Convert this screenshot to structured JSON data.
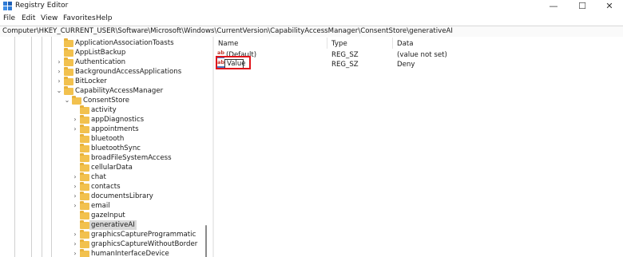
{
  "window": {
    "title": "Registry Editor",
    "icon": "registry-editor-icon"
  },
  "controls": {
    "minimize": "—",
    "maximize": "☐",
    "close": "✕"
  },
  "menu": [
    "File",
    "Edit",
    "View",
    "Favorites",
    "Help"
  ],
  "address": "Computer\\HKEY_CURRENT_USER\\Software\\Microsoft\\Windows\\CurrentVersion\\CapabilityAccessManager\\ConsentStore\\generativeAI",
  "tree": [
    {
      "label": "ApplicationAssociationToasts",
      "chev": ""
    },
    {
      "label": "AppListBackup",
      "chev": ""
    },
    {
      "label": "Authentication",
      "chev": "›"
    },
    {
      "label": "BackgroundAccessApplications",
      "chev": "›"
    },
    {
      "label": "BitLocker",
      "chev": "›"
    },
    {
      "label": "CapabilityAccessManager",
      "chev": "⌄"
    },
    {
      "label": "ConsentStore",
      "chev": "⌄"
    },
    {
      "label": "activity",
      "chev": ""
    },
    {
      "label": "appDiagnostics",
      "chev": "›"
    },
    {
      "label": "appointments",
      "chev": "›"
    },
    {
      "label": "bluetooth",
      "chev": ""
    },
    {
      "label": "bluetoothSync",
      "chev": ""
    },
    {
      "label": "broadFileSystemAccess",
      "chev": ""
    },
    {
      "label": "cellularData",
      "chev": ""
    },
    {
      "label": "chat",
      "chev": "›"
    },
    {
      "label": "contacts",
      "chev": "›"
    },
    {
      "label": "documentsLibrary",
      "chev": "›"
    },
    {
      "label": "email",
      "chev": "›"
    },
    {
      "label": "gazeInput",
      "chev": ""
    },
    {
      "label": "generativeAI",
      "chev": "",
      "selected": true
    },
    {
      "label": "graphicsCaptureProgrammatic",
      "chev": "›"
    },
    {
      "label": "graphicsCaptureWithoutBorder",
      "chev": "›"
    },
    {
      "label": "humanInterfaceDevice",
      "chev": "›"
    }
  ],
  "list": {
    "columns": [
      "Name",
      "Type",
      "Data"
    ],
    "rows": [
      {
        "name": "(Default)",
        "type": "REG_SZ",
        "data": "(value not set)"
      },
      {
        "name": "Value",
        "type": "REG_SZ",
        "data": "Deny",
        "editing": true
      }
    ]
  },
  "icons": {
    "value_icon": "string-value-icon",
    "tree_icon": "folder-icon"
  },
  "colors": {
    "highlight": "#e0151b",
    "folder": "#f2c14e",
    "selected": "#d9d9d9"
  }
}
